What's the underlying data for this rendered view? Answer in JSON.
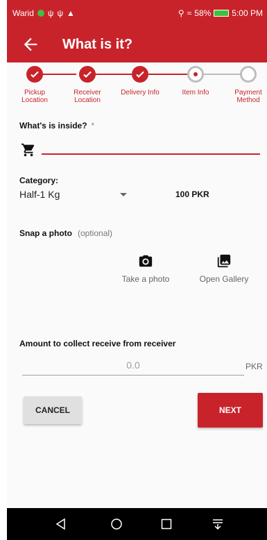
{
  "status_bar": {
    "carrier": "Warid",
    "battery_percent": "58%",
    "time": "5:00 PM",
    "signal_text": " ⁳ııl"
  },
  "app_bar": {
    "title": "What is it?"
  },
  "stepper": {
    "steps": [
      {
        "label": "Pickup\nLocation",
        "state": "done"
      },
      {
        "label": "Receiver\nLocation",
        "state": "done"
      },
      {
        "label": "Delivery Info",
        "state": "done"
      },
      {
        "label": "Item Info",
        "state": "active"
      },
      {
        "label": "Payment\nMethod",
        "state": "todo"
      }
    ]
  },
  "form": {
    "inside_label": "What's is inside?",
    "inside_required": "*",
    "inside_value": "",
    "category_label": "Category:",
    "category_value": "Half-1 Kg",
    "price": "100 PKR",
    "photo_label": "Snap a photo",
    "photo_optional": "(optional)",
    "take_photo": "Take a photo",
    "open_gallery": "Open Gallery",
    "amount_label": "Amount to collect receive from receiver",
    "amount_value": "0.0",
    "amount_unit": "PKR"
  },
  "actions": {
    "cancel": "CANCEL",
    "next": "NEXT"
  },
  "colors": {
    "primary": "#c8232b",
    "inactive": "#bdbdbd"
  },
  "icons": [
    "back-arrow-icon",
    "cart-icon",
    "camera-icon",
    "gallery-icon",
    "nav-back-icon",
    "nav-home-icon",
    "nav-recents-icon",
    "nav-notifications-icon"
  ]
}
